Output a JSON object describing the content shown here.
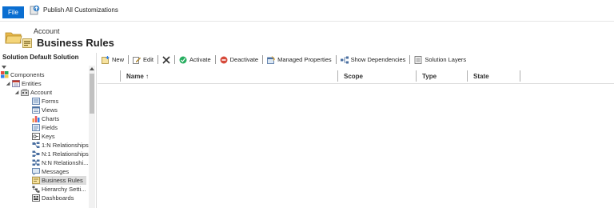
{
  "ribbon": {
    "file_label": "File",
    "publish_label": "Publish All Customizations"
  },
  "header": {
    "entity": "Account",
    "title": "Business Rules"
  },
  "sidebar": {
    "title": "Solution Default Solution",
    "items": [
      {
        "label": "Components",
        "icon": "components-icon"
      },
      {
        "label": "Entities",
        "icon": "entities-icon"
      },
      {
        "label": "Account",
        "icon": "account-entity-icon"
      },
      {
        "label": "Forms",
        "icon": "forms-icon"
      },
      {
        "label": "Views",
        "icon": "views-icon"
      },
      {
        "label": "Charts",
        "icon": "charts-icon"
      },
      {
        "label": "Fields",
        "icon": "fields-icon"
      },
      {
        "label": "Keys",
        "icon": "keys-icon"
      },
      {
        "label": "1:N Relationships",
        "icon": "relationship-icon"
      },
      {
        "label": "N:1 Relationships",
        "icon": "relationship-icon"
      },
      {
        "label": "N:N Relationshi...",
        "icon": "relationship-icon"
      },
      {
        "label": "Messages",
        "icon": "messages-icon"
      },
      {
        "label": "Business Rules",
        "icon": "business-rules-icon"
      },
      {
        "label": "Hierarchy Setti...",
        "icon": "hierarchy-icon"
      },
      {
        "label": "Dashboards",
        "icon": "dashboards-icon"
      }
    ]
  },
  "commands": {
    "new": "New",
    "edit": "Edit",
    "activate": "Activate",
    "deactivate": "Deactivate",
    "managed_properties": "Managed Properties",
    "show_dependencies": "Show Dependencies",
    "solution_layers": "Solution Layers"
  },
  "grid": {
    "columns": [
      "Name ↑",
      "Scope",
      "Type",
      "State"
    ]
  },
  "colors": {
    "file_button": "#0a6ed1",
    "selected_row": "#dcdcdc"
  }
}
